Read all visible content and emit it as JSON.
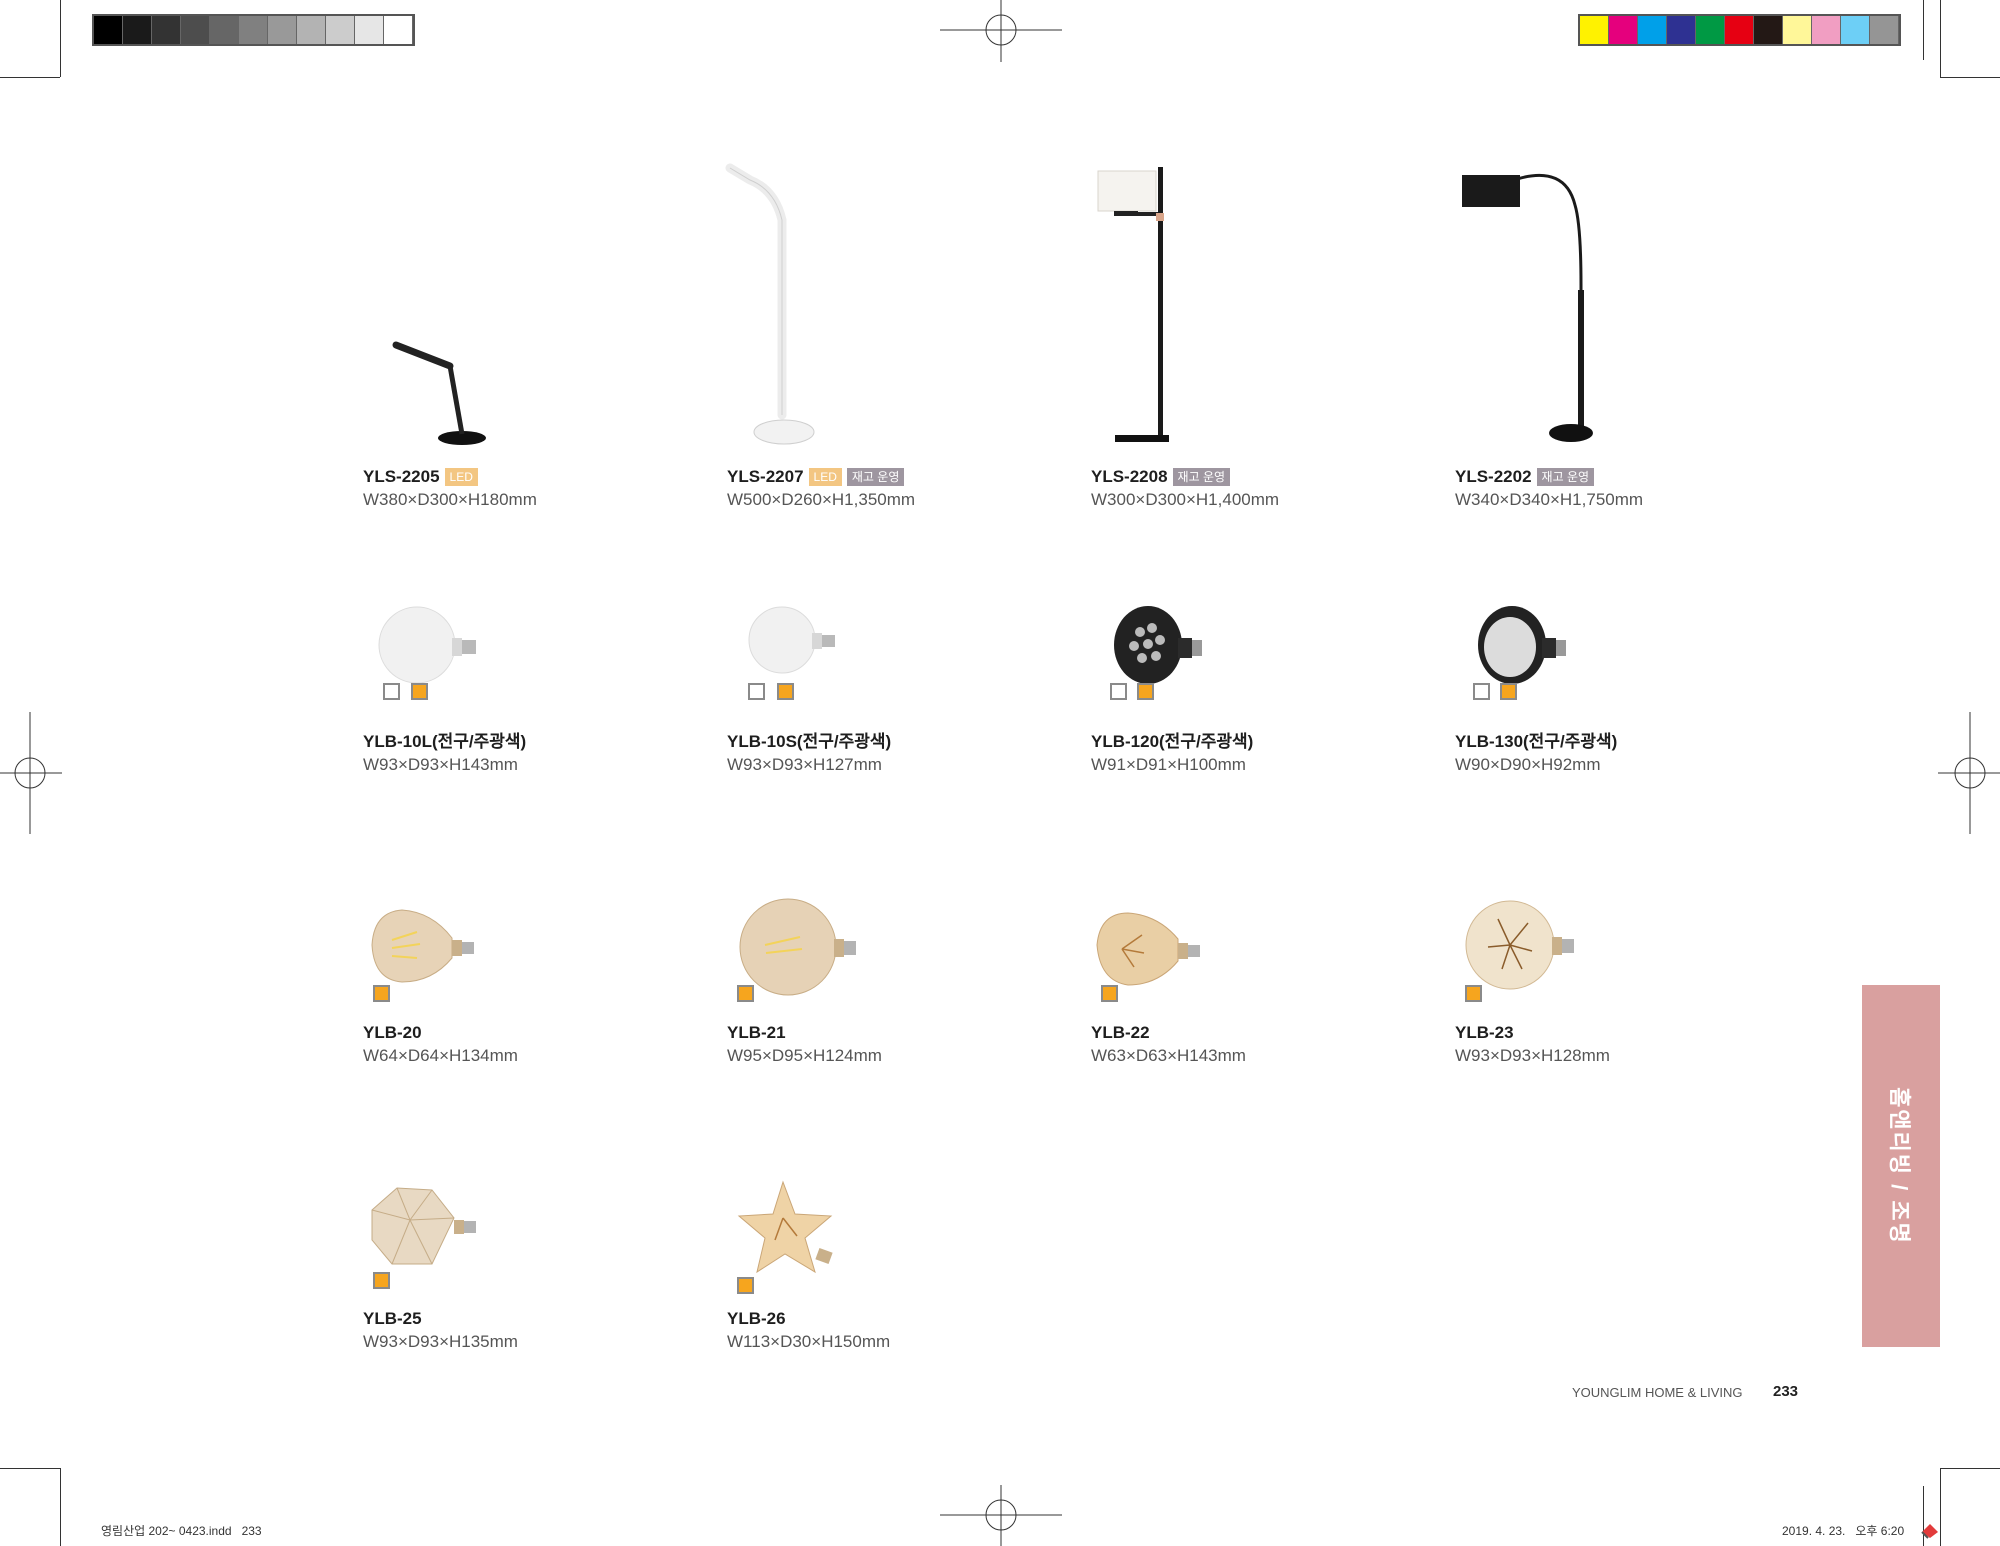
{
  "colors": {
    "gray_bar": [
      "#000000",
      "#1a1a1a",
      "#333333",
      "#4d4d4d",
      "#666666",
      "#808080",
      "#999999",
      "#b3b3b3",
      "#cccccc",
      "#e6e6e6",
      "#ffffff"
    ],
    "color_bar": [
      "#fff200",
      "#e5007d",
      "#00a0e9",
      "#2e3192",
      "#009944",
      "#e60012",
      "#231815",
      "#fff799",
      "#f19ec2",
      "#6dcff6",
      "#959595"
    ],
    "led_tag": "#f3c682",
    "stock_tag": "#9e96a0",
    "side_tab": "#d9a09f",
    "swatch_warm": "#f6a51e"
  },
  "products": [
    {
      "name": "YLS-2205",
      "tags": [
        "LED"
      ],
      "dims": "W380×D300×H180mm",
      "image": "desk-lamp"
    },
    {
      "name": "YLS-2207",
      "tags": [
        "LED",
        "재고 운영"
      ],
      "dims": "W500×D260×H1,350mm",
      "image": "white-floor-lamp"
    },
    {
      "name": "YLS-2208",
      "tags": [
        "재고 운영"
      ],
      "dims": "W300×D300×H1,400mm",
      "image": "shade-floor-lamp"
    },
    {
      "name": "YLS-2202",
      "tags": [
        "재고 운영"
      ],
      "dims": "W340×D340×H1,750mm",
      "image": "arc-floor-lamp"
    },
    {
      "name": "YLB-10L(전구/주광색)",
      "tags": [],
      "dims": "W93×D93×H143mm",
      "image": "globe-bulb-large"
    },
    {
      "name": "YLB-10S(전구/주광색)",
      "tags": [],
      "dims": "W93×D93×H127mm",
      "image": "globe-bulb-small"
    },
    {
      "name": "YLB-120(전구/주광색)",
      "tags": [],
      "dims": "W91×D91×H100mm",
      "image": "par-bulb-led"
    },
    {
      "name": "YLB-130(전구/주광색)",
      "tags": [],
      "dims": "W90×D90×H92mm",
      "image": "par-bulb-cob"
    },
    {
      "name": "YLB-20",
      "tags": [],
      "dims": "W64×D64×H134mm",
      "image": "edison-st64-bulb"
    },
    {
      "name": "YLB-21",
      "tags": [],
      "dims": "W95×D95×H124mm",
      "image": "edison-globe-bulb"
    },
    {
      "name": "YLB-22",
      "tags": [],
      "dims": "W63×D63×H143mm",
      "image": "edison-star-st-bulb"
    },
    {
      "name": "YLB-23",
      "tags": [],
      "dims": "W93×D93×H128mm",
      "image": "edison-firework-bulb"
    },
    {
      "name": "YLB-25",
      "tags": [],
      "dims": "W93×D93×H135mm",
      "image": "diamond-bulb"
    },
    {
      "name": "YLB-26",
      "tags": [],
      "dims": "W113×D30×H150mm",
      "image": "star-bulb"
    }
  ],
  "side_tab": {
    "text": "홈앤리빙 / 조명"
  },
  "footer": {
    "brand": "YOUNGLIM HOME & LIVING",
    "page_number": "233",
    "file_info": "영림산업 202~ 0423.indd   233",
    "timestamp": "2019. 4. 23.   오후 6:20"
  }
}
